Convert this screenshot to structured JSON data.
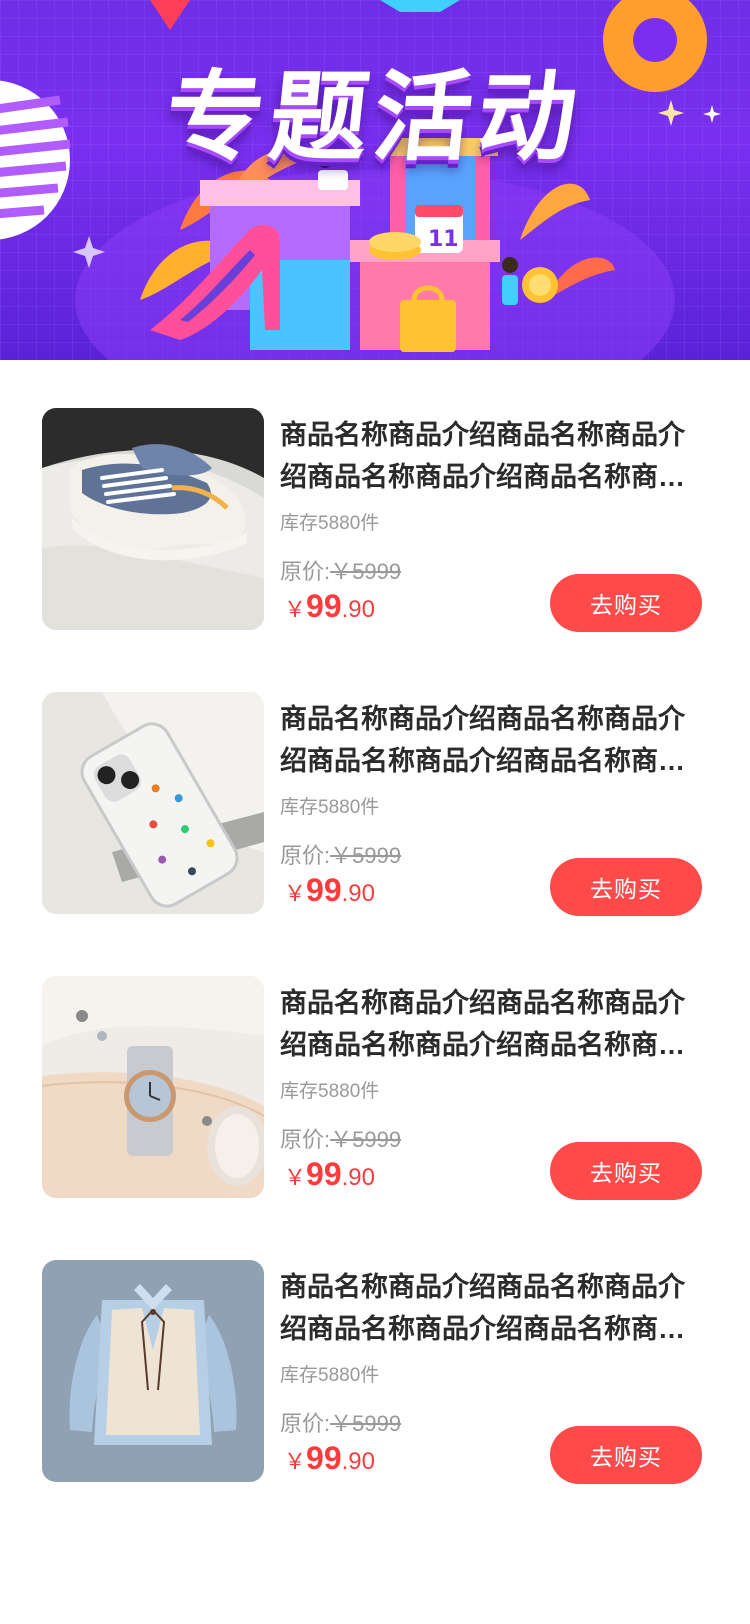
{
  "banner": {
    "title": "专题活动"
  },
  "products": [
    {
      "title": "商品名称商品介绍商品名称商品介绍商品名称商品介绍商品名称商品介绍",
      "stock": "库存5880件",
      "orig_label": "原价:",
      "orig_value": "￥5999",
      "price_currency": "￥",
      "price_int": "99",
      "price_dec": ".90",
      "buy_label": "去购买",
      "image": "sneaker"
    },
    {
      "title": "商品名称商品介绍商品名称商品介绍商品名称商品介绍商品名称商品介绍",
      "stock": "库存5880件",
      "orig_label": "原价:",
      "orig_value": "￥5999",
      "price_currency": "￥",
      "price_int": "99",
      "price_dec": ".90",
      "buy_label": "去购买",
      "image": "phone-case"
    },
    {
      "title": "商品名称商品介绍商品名称商品介绍商品名称商品介绍商品名称商品介绍",
      "stock": "库存5880件",
      "orig_label": "原价:",
      "orig_value": "￥5999",
      "price_currency": "￥",
      "price_int": "99",
      "price_dec": ".90",
      "buy_label": "去购买",
      "image": "wrist-watch"
    },
    {
      "title": "商品名称商品介绍商品名称商品介绍商品名称商品介绍商品名称商品介绍",
      "stock": "库存5880件",
      "orig_label": "原价:",
      "orig_value": "￥5999",
      "price_currency": "￥",
      "price_int": "99",
      "price_dec": ".90",
      "buy_label": "去购买",
      "image": "shirt-vest"
    }
  ],
  "colors": {
    "price": "#ff3b3b",
    "button": "#ff4a4a",
    "banner": "#6e2ee6"
  }
}
